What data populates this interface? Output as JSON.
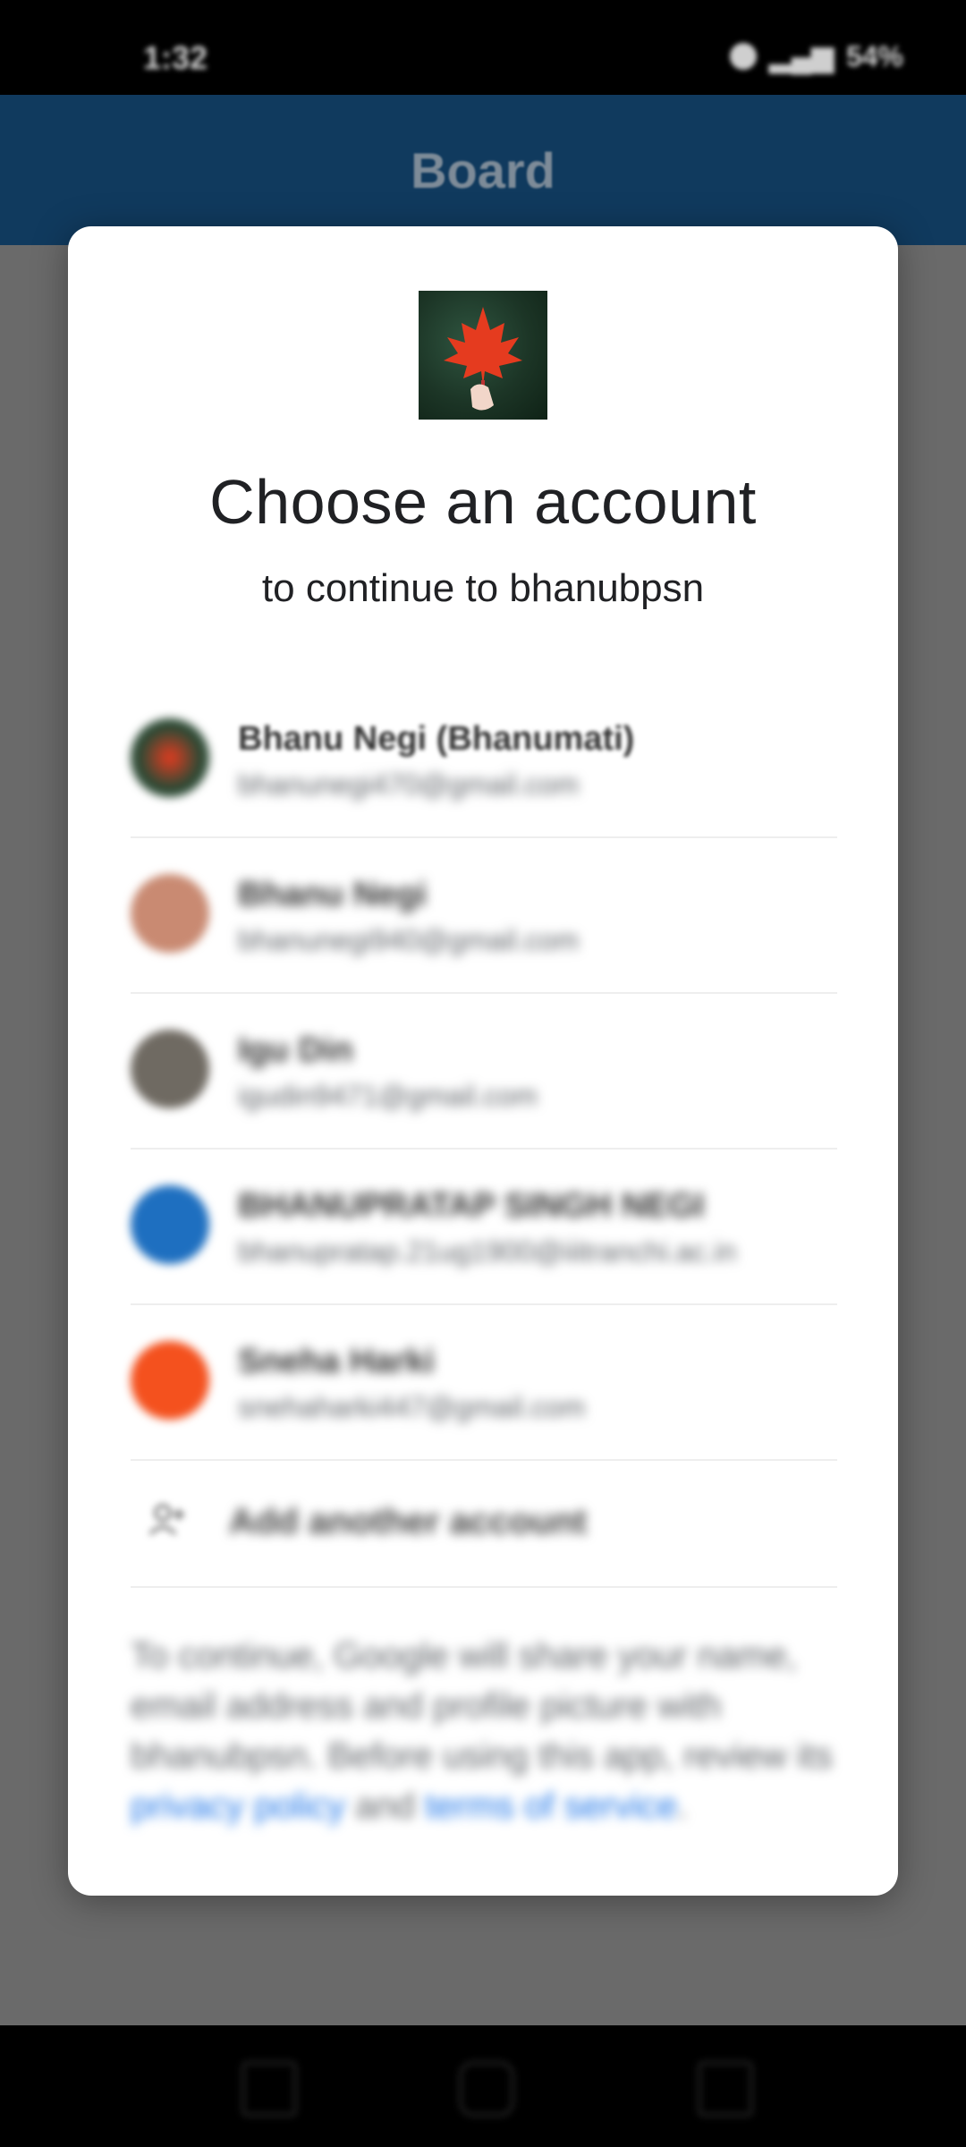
{
  "status_bar": {
    "time": "1:32",
    "battery": "54%"
  },
  "app_bar": {
    "title": "Board"
  },
  "dialog": {
    "title": "Choose an account",
    "subtitle": "to continue to bhanubpsn",
    "accounts": [
      {
        "name": "Bhanu Negi (Bhanumati)",
        "email": "bhanunegi470@gmail.com",
        "avatar_color": "#2d4a35"
      },
      {
        "name": "Bhanu Negi",
        "email": "bhanunegi940@gmail.com",
        "avatar_color": "#c98a72"
      },
      {
        "name": "Igu Din",
        "email": "igudin9471@gmail.com",
        "avatar_color": "#6f6a62"
      },
      {
        "name": "BHANUPRATAP SINGH NEGI",
        "email": "bhanupratap.21ug1900@iiitranchi.ac.in",
        "avatar_color": "#1e6fc0"
      },
      {
        "name": "Sneha Harki",
        "email": "snehaharki447@gmail.com",
        "avatar_color": "#f4511e"
      }
    ],
    "add_account_label": "Add another account",
    "disclaimer": {
      "text_before": "To continue, Google will share your name, email address and profile picture with bhanubpsn. Before using this app, review its ",
      "privacy_link": "privacy policy",
      "and_text": " and ",
      "terms_link": "terms of service",
      "text_after": "."
    }
  },
  "icons": {
    "app_logo": "maple-leaf-icon",
    "add_account": "add-person-icon",
    "nav": [
      "recents-icon",
      "home-icon",
      "back-icon"
    ]
  }
}
